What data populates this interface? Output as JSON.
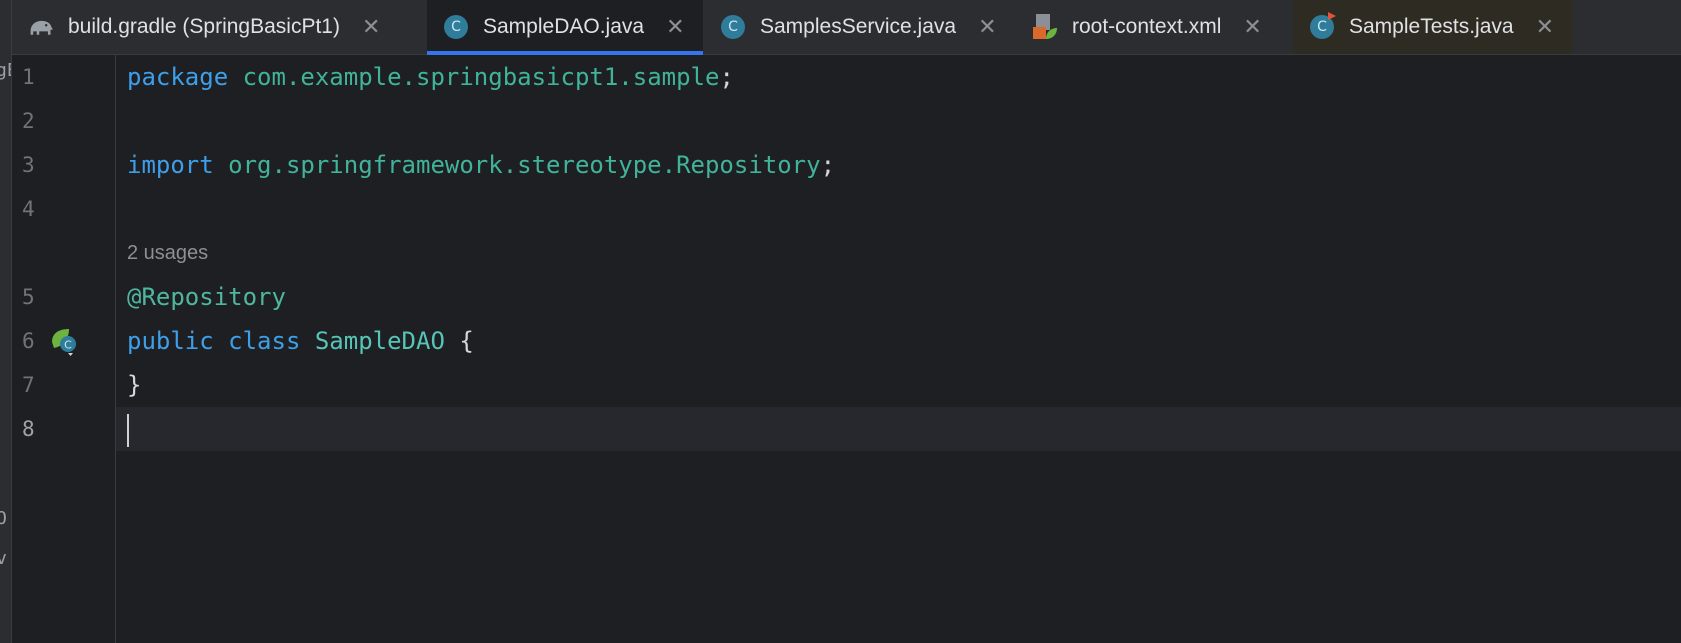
{
  "tabs": [
    {
      "label": "build.gradle (SpringBasicPt1)",
      "icon": "gradle-elephant-icon",
      "active": false
    },
    {
      "label": "SampleDAO.java",
      "icon": "java-class-icon",
      "active": true
    },
    {
      "label": "SamplesService.java",
      "icon": "java-class-icon",
      "active": false
    },
    {
      "label": "root-context.xml",
      "icon": "spring-xml-icon",
      "active": false
    },
    {
      "label": "SampleTests.java",
      "icon": "java-test-class-icon",
      "active": false
    }
  ],
  "icons": {
    "class_badge": "C",
    "close": "✕"
  },
  "left_strip": {
    "frag_top": "gE",
    "frag_mid": "O",
    "frag_bot": "v"
  },
  "editor": {
    "line_numbers": [
      "1",
      "2",
      "3",
      "4",
      "5",
      "6",
      "7",
      "8"
    ],
    "usage_hint": "2 usages",
    "code": {
      "l1_kw": "package",
      "l1_pkg": "com.example.springbasicpt1.sample",
      "l1_end": ";",
      "l3_kw": "import",
      "l3_pkg": "org.springframework.stereotype.Repository",
      "l3_end": ";",
      "l5_ann": "@Repository",
      "l6_kw1": "public",
      "l6_kw2": "class",
      "l6_cls": "SampleDAO",
      "l6_brace": "{",
      "l7_brace": "}"
    }
  },
  "colors": {
    "keyword": "#3e9fe8",
    "package": "#40b39a",
    "annotation": "#4fb7a0",
    "active_tab_underline": "#3574f0"
  }
}
